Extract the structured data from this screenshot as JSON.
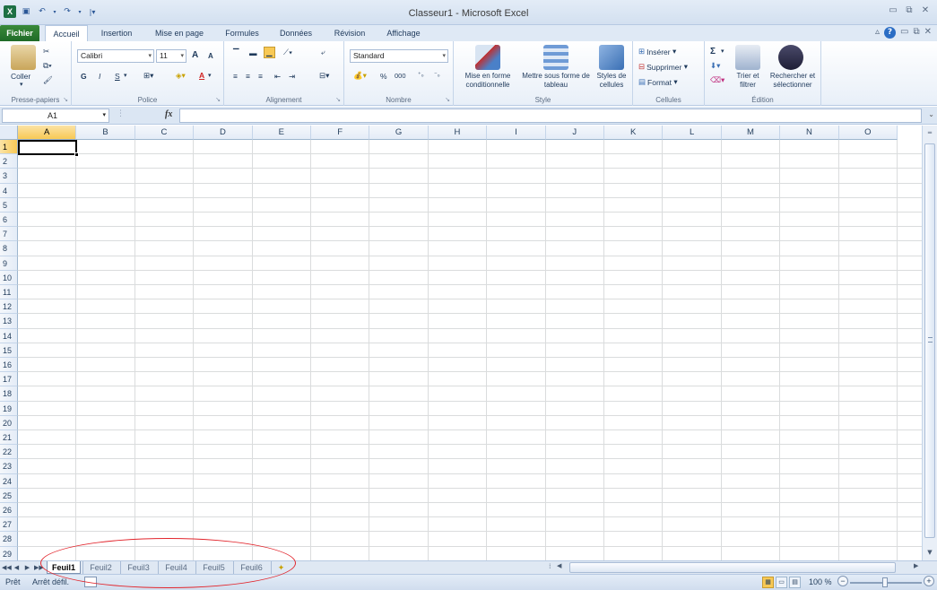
{
  "window": {
    "title": "Classeur1 - Microsoft Excel",
    "app_icon_letter": "X"
  },
  "qat": {
    "save_icon": "save-icon",
    "undo_icon": "undo-icon",
    "redo_icon": "redo-icon"
  },
  "tabs": {
    "file": "Fichier",
    "items": [
      "Accueil",
      "Insertion",
      "Mise en page",
      "Formules",
      "Données",
      "Révision",
      "Affichage"
    ],
    "active": "Accueil"
  },
  "ribbon": {
    "clipboard": {
      "label": "Presse-papiers",
      "paste": "Coller"
    },
    "font": {
      "label": "Police",
      "name": "Calibri",
      "size": "11",
      "bold": "G",
      "italic": "I",
      "underline": "S",
      "grow": "A",
      "shrink": "A",
      "color_letter": "A"
    },
    "alignment": {
      "label": "Alignement"
    },
    "number": {
      "label": "Nombre",
      "format": "Standard",
      "percent": "%",
      "thousands": "000"
    },
    "styles": {
      "label": "Style",
      "conditional": "Mise en forme conditionnelle",
      "table": "Mettre sous forme de tableau",
      "cell_styles": "Styles de cellules"
    },
    "cells": {
      "label": "Cellules",
      "insert": "Insérer",
      "delete": "Supprimer",
      "format": "Format"
    },
    "editing": {
      "label": "Édition",
      "sum": "Σ",
      "sort": "Trier et filtrer",
      "find": "Rechercher et sélectionner"
    }
  },
  "formula_bar": {
    "name_box": "A1",
    "fx": "fx",
    "value": ""
  },
  "grid": {
    "columns": [
      "A",
      "B",
      "C",
      "D",
      "E",
      "F",
      "G",
      "H",
      "I",
      "J",
      "K",
      "L",
      "M",
      "N",
      "O"
    ],
    "rows": [
      "1",
      "2",
      "3",
      "4",
      "5",
      "6",
      "7",
      "8",
      "9",
      "10",
      "11",
      "12",
      "13",
      "14",
      "15",
      "16",
      "17",
      "18",
      "19",
      "20",
      "21",
      "22",
      "23",
      "24",
      "25",
      "26",
      "27",
      "28",
      "29"
    ],
    "selected_cell": "A1"
  },
  "sheets": {
    "tabs": [
      "Feuil1",
      "Feuil2",
      "Feuil3",
      "Feuil4",
      "Feuil5",
      "Feuil6"
    ],
    "active": "Feuil1"
  },
  "status": {
    "ready": "Prêt",
    "macro": "Arrêt défil.",
    "zoom": "100 %",
    "zoom_out": "−",
    "zoom_in": "+"
  },
  "colors": {
    "file_tab": "#1f6b28",
    "accent_border": "#b6c9e2",
    "highlight_ellipse": "#e2262d",
    "selection": "#f8c955"
  }
}
